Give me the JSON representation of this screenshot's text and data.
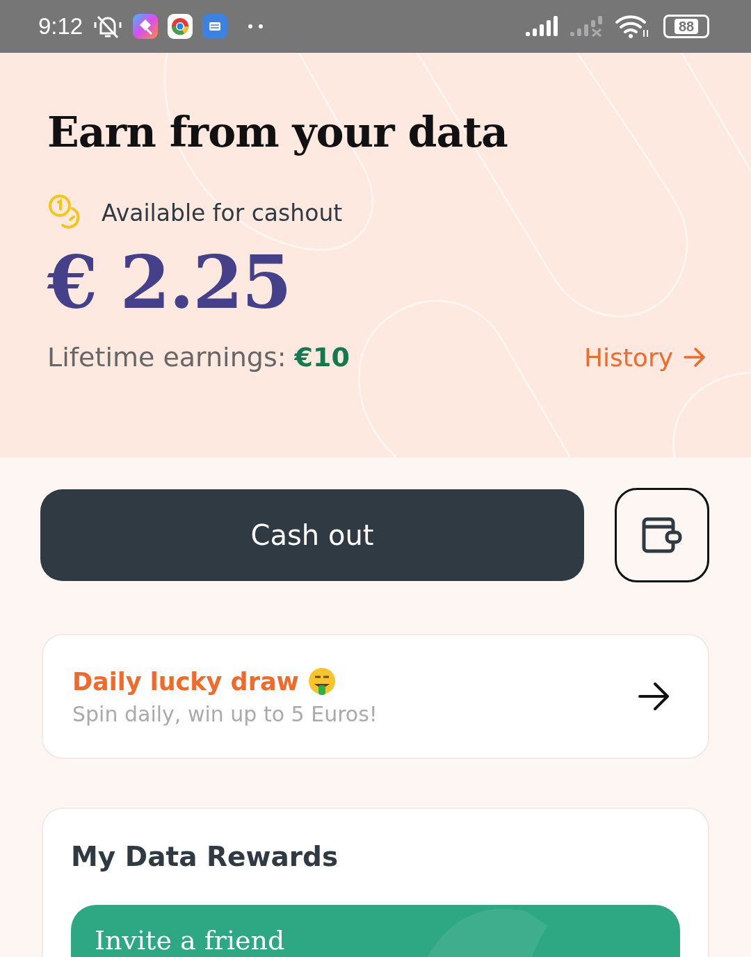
{
  "status_bar": {
    "time": "9:12",
    "battery": "88"
  },
  "header": {
    "title": "Earn from your data",
    "available_label": "Available for cashout",
    "amount": "€ 2.25",
    "lifetime": "Lifetime earnings: **€10**",
    "history_link": "History"
  },
  "cash_out_button": "Cash out",
  "daily_draw": {
    "title": "Daily lucky draw",
    "subtitle": "Spin daily, win up to 5 Euros!"
  },
  "rewards": {
    "title": "My Data Rewards",
    "cards": [
      {
        "title": "Invite a friend"
      }
    ]
  }
}
